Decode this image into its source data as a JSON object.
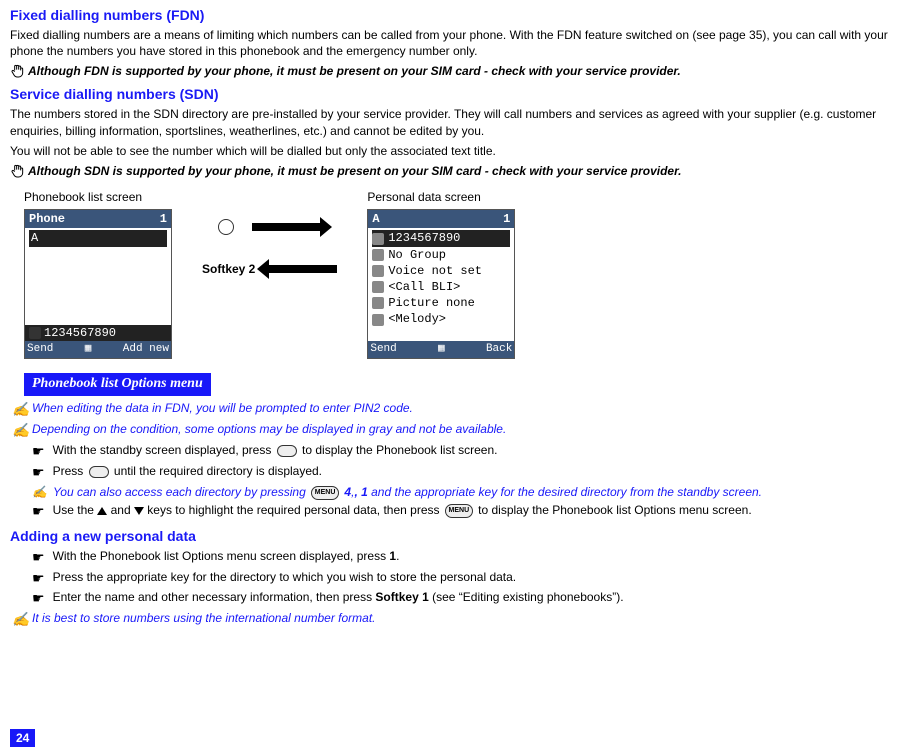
{
  "fdn": {
    "heading": "Fixed dialling numbers (FDN)",
    "body": "Fixed dialling numbers are a means of limiting which numbers can be called from your phone. With the FDN feature switched on (see page 35), you can call with your phone the numbers you have stored in this phonebook and the emergency number only.",
    "note": "Although FDN is supported by your phone, it must be present on your SIM  card  - check with your service provider."
  },
  "sdn": {
    "heading": "Service dialling numbers (SDN)",
    "body1": "The numbers stored in the SDN directory are pre-installed by your service provider. They will call numbers and services as agreed with your supplier (e.g. customer enquiries, billing information, sportslines, weatherlines, etc.) and cannot be edited by you.",
    "body2": "You will not be able to see the number which will be dialled but only the associated text title.",
    "note": "Although SDN is supported by your phone, it must be present on your SIM  card  - check with your service provider."
  },
  "screens": {
    "leftLabel": "Phonebook list screen",
    "rightLabel": "Personal data screen",
    "softkey2": "Softkey 2",
    "left": {
      "headerLeft": "Phone",
      "headerRight": "1",
      "listEntry": "A",
      "bottomNumber": "1234567890",
      "softLeft": "Send",
      "softRight": "Add new"
    },
    "right": {
      "headerLeft": "A",
      "headerRight": "1",
      "lines": [
        "1234567890",
        "No Group",
        "Voice not set",
        "<Call BLI>",
        "Picture none",
        "<Melody>"
      ],
      "softLeft": "Send",
      "softRight": "Back"
    }
  },
  "optionsMenu": {
    "bar": "Phonebook list Options menu",
    "info1": "When editing the data in FDN, you will be prompted to enter PIN2 code.",
    "info2": "Depending on the condition, some options may be displayed in gray and not be available.",
    "step1a": "With the standby screen displayed, press ",
    "step1b": " to display the Phonebook list screen.",
    "step2a": "Press ",
    "step2b": " until the required directory is displayed.",
    "infoInnerA": "You can also access each directory by pressing ",
    "infoInnerB": " 4",
    "infoInnerC": ", 1",
    "infoInnerD": " and the appropriate key for the desired directory from the standby screen.",
    "step3a": "Use the ",
    "step3b": " and ",
    "step3c": " keys to highlight the required personal data, then press ",
    "step3d": "  to display the Phonebook list Options menu screen.",
    "menuLabel": "MENU"
  },
  "adding": {
    "heading": "Adding a new personal data",
    "step1": "With the Phonebook list Options menu screen displayed, press ",
    "step1bold": "1",
    "step1end": ".",
    "step2": "Press the appropriate key for the directory to which you wish to store the personal data.",
    "step3a": "Enter the name and other necessary information, then press ",
    "step3bold": "Softkey 1",
    "step3b": " (see “Editing existing phonebooks”).",
    "info": "It is best to store numbers using the international number format."
  },
  "pageNumber": "24"
}
